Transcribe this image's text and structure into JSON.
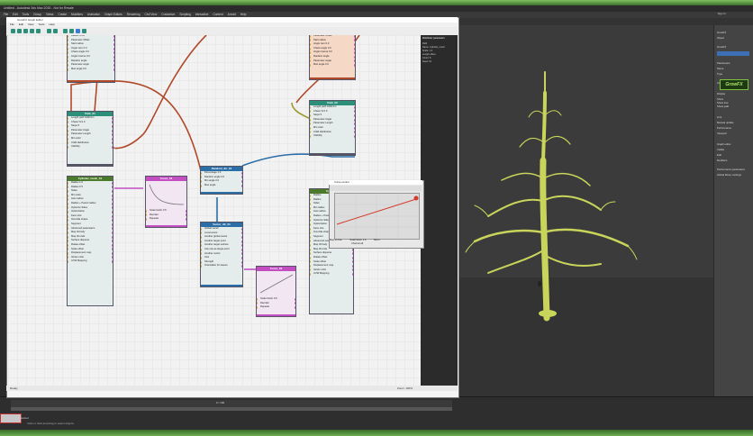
{
  "app": {
    "title": "Untitled - Autodesk 3ds Max 2020 - Not for Resale",
    "menu": [
      "File",
      "Edit",
      "Tools",
      "Group",
      "Views",
      "Create",
      "Modifiers",
      "Animation",
      "Graph Editors",
      "Rendering",
      "Civil View",
      "Customize",
      "Scripting",
      "Interactive",
      "Content",
      "Arnold",
      "Help"
    ],
    "sign_in": "Sign In"
  },
  "graph_editor": {
    "title": "GrowFX Graph Editor",
    "menu": [
      "File",
      "Edit",
      "View",
      "Tools",
      "Help"
    ],
    "status_left": "Ready",
    "status_right": "Zoom: 100%"
  },
  "props_panel": {
    "header": "Distributor parameters",
    "rows": [
      "Path",
      "Name: Cylinder_mesh",
      "Scale: 1.0",
      "Length offset",
      "Count: 8",
      "Seed: 10"
    ]
  },
  "nodes": {
    "path_top_left": {
      "rows": [
        "Radius 0.0m",
        "Parameter Offset",
        "Start radius",
        "Angle zero 0.0",
        "Chaos angle 0.0",
        "Angle inverse 0.0",
        "Random angle",
        "Parameter angle",
        "Max angle 0.0"
      ]
    },
    "path_top_right": {
      "rows": [
        "Parameter Offset",
        "Start radius",
        "Angle zero 0.0",
        "Chaos angle 0.0",
        "Angle inverse 0.0",
        "Random angle",
        "Parameter angle",
        "Max angle 0.0"
      ]
    },
    "path01": {
      "title": "Path_01",
      "rows": [
        "Length path 1000.0m",
        "Chaos % 0.0",
        "Steps 5",
        "Parameter Angle",
        "Parameter Length",
        "Min color",
        "Child distribution",
        "Visibility"
      ]
    },
    "path02": {
      "title": "Path_02",
      "rows": [
        "Length path 1000.0m",
        "Chaos % 0.0",
        "Steps 5",
        "Parameter Angle",
        "Parameter Length",
        "Min color",
        "Child distribution",
        "Visibility"
      ]
    },
    "cylinder_mesh": {
      "title": "Cylinder_mesh_01",
      "rows": [
        "Radius 1.0",
        "Radius 0.5",
        "Sides",
        "Min color",
        "Auto radius",
        "Radius + Parent radius",
        "Optimize Sides",
        "Optimization",
        "Face size",
        "Override shape",
        "Segment",
        "Advanced parameters",
        "Map ID body",
        "Map ID ends",
        "Surface disperse",
        "Rotate offset",
        "Scale offset",
        "Displacement map",
        "Vertex color",
        "UVW Mapping"
      ]
    },
    "curve01": {
      "title": "Curve_01",
      "rows": [
        "Scale factor 0.5",
        "Reorder",
        "Repeats"
      ]
    },
    "random_dir": {
      "title": "Random_dir_01",
      "rows": [
        "Percentage 1.0",
        "Random angle 0.0",
        "Min angle 0.0",
        "Max angle"
      ]
    },
    "vector_dir": {
      "title": "Vector_dir_01",
      "rows": [
        "Global vector",
        "Local vector",
        "Another global vector",
        "Another target point",
        "Another target surface",
        "Use raw as target point",
        "Another vector",
        "Axis",
        "Strength",
        "Orientation for leaves"
      ]
    },
    "curve02": {
      "title": "Curve_02",
      "rows": [
        "Scale factor 0.5",
        "Reorder",
        "Repeats"
      ]
    },
    "cylinder2": {
      "title": "Cylinder",
      "rows": [
        "Radius",
        "Radius",
        "Sides",
        "Min radius",
        "Auto radius",
        "Radius + Parent radius",
        "Optimize Sides",
        "Optimization",
        "Face size",
        "Override shape",
        "Segment",
        "Advanced parameters",
        "Map ID body",
        "Map ID ends",
        "Surface disperse",
        "Rotate offset",
        "Scale offset",
        "Displacement map",
        "Vertex color",
        "UVW Mapping"
      ]
    }
  },
  "curve_editor": {
    "title": "Curve control",
    "footer_left": "Map to time",
    "footer_mid": "Scale factor 1.0",
    "footer_right": "Mirror",
    "footer2": "Channel all"
  },
  "command_panel": {
    "rows": [
      "GrowFX",
      "Object",
      "GrowFX",
      "Parameters",
      "Name",
      "Type",
      "Interpreted",
      "Display",
      "Show",
      "Show tree",
      "Show path",
      "Link",
      "Manual update",
      "Performance",
      "Viewport",
      "Graph editor",
      "Visible",
      "Edit",
      "Modifiers",
      "Performance parameters",
      "Global library settings"
    ],
    "logo": "GrowFX"
  },
  "timeline": {
    "range": "0 / 100",
    "status": "1 Object Selected",
    "hint": "Click or click-and-drag to select objects"
  },
  "colors": {
    "node_header": "#e57f43",
    "node_header2": "#2c8f7a",
    "node_header3": "#c24ec2",
    "wire_brown": "#b04a2a",
    "wire_blue": "#2b6ea7",
    "wire_magenta": "#c24ec2",
    "wire_olive": "#9a9a2a",
    "tree": "#c8d45a"
  }
}
